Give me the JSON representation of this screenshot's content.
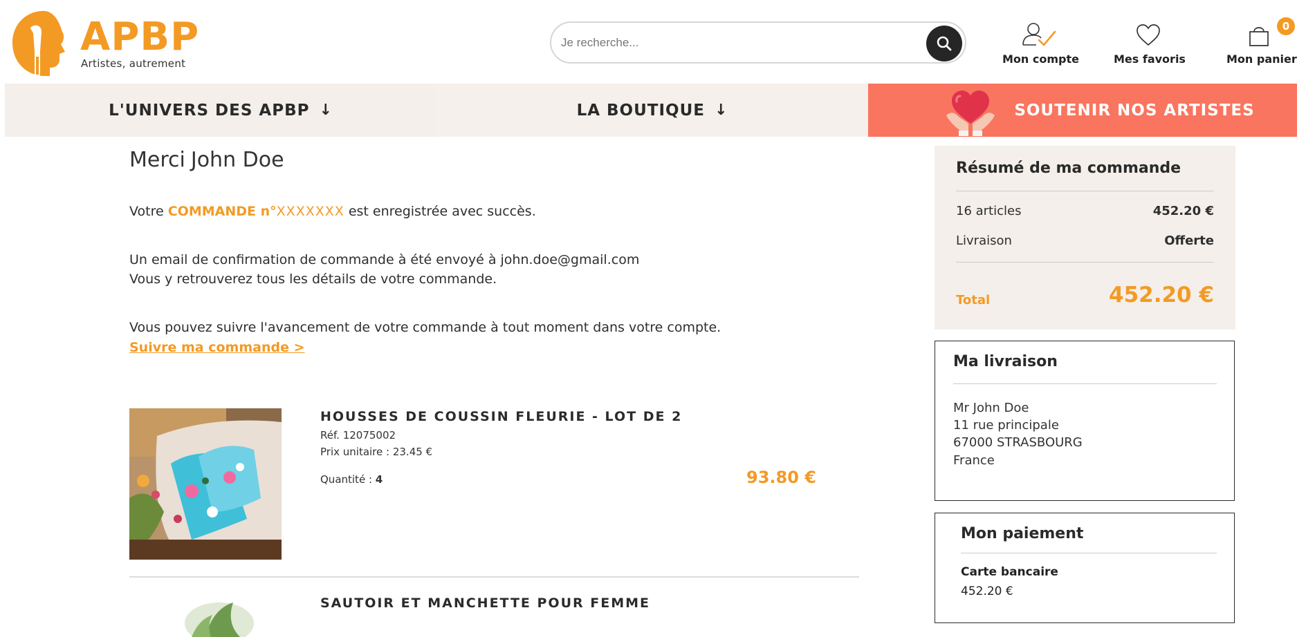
{
  "brand": {
    "name": "APBP",
    "tagline": "Artistes, autrement",
    "color": "#f39a24"
  },
  "search": {
    "placeholder": "Je recherche...",
    "icon": "search-icon"
  },
  "header_actions": {
    "account": {
      "label": "Mon compte",
      "icon": "user-check-icon"
    },
    "favorites": {
      "label": "Mes favoris",
      "icon": "heart-icon"
    },
    "cart": {
      "label": "Mon panier",
      "icon": "shopping-bag-icon",
      "count": "0"
    }
  },
  "nav": {
    "items": [
      {
        "label": "L'UNIVERS DES APBP",
        "arrow": "↓"
      },
      {
        "label": "LA BOUTIQUE",
        "arrow": "↓"
      },
      {
        "label": "SOUTENIR NOS ARTISTES",
        "icon": "heart-hands-icon"
      }
    ],
    "accent": "#f9755f"
  },
  "confirmation": {
    "merci": "Merci",
    "customer_name": "John Doe",
    "order_prefix": "Votre",
    "order_label": "COMMANDE n°",
    "order_number": "XXXXXXX",
    "order_suffix": "est enregistrée avec succès.",
    "email_line": "Un email de confirmation de commande à été envoyé à",
    "email": "john.doe@gmail.com",
    "details_line": "Vous y retrouverez tous les détails de votre commande.",
    "follow_line": "Vous pouvez suivre l'avancement de votre commande à tout moment dans votre compte.",
    "follow_link": "Suivre ma commande >"
  },
  "products": [
    {
      "title": "HOUSSES DE COUSSIN FLEURIE - LOT DE 2",
      "ref": "Réf. 12075002",
      "unit_price": "Prix unitaire : 23.45 €",
      "qty_label": "Quantité :",
      "qty": "4",
      "price": "93.80 €"
    },
    {
      "title": "SAUTOIR ET MANCHETTE POUR FEMME"
    }
  ],
  "summary": {
    "title": "Résumé de ma commande",
    "articles_label": "16 articles",
    "articles_value": "452.20 €",
    "shipping_label": "Livraison",
    "shipping_value": "Offerte",
    "total_label": "Total",
    "total_value": "452.20 €"
  },
  "delivery": {
    "title": "Ma livraison",
    "name": "Mr John Doe",
    "street": "11 rue principale",
    "city": "67000 STRASBOURG",
    "country": "France"
  },
  "payment": {
    "title": "Mon paiement",
    "method": "Carte bancaire",
    "amount": "452.20 €"
  }
}
